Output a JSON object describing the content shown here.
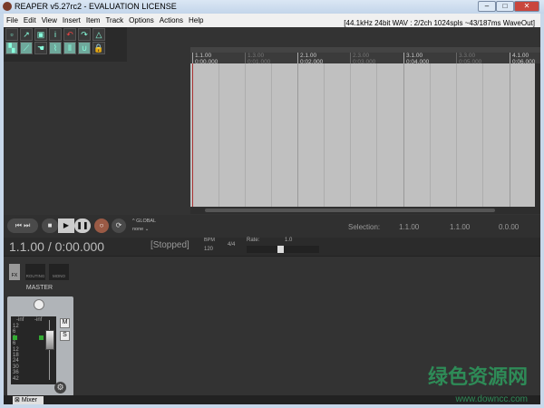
{
  "window": {
    "title": "REAPER v5.27rc2 - EVALUATION LICENSE"
  },
  "menu": [
    "File",
    "Edit",
    "View",
    "Insert",
    "Item",
    "Track",
    "Options",
    "Actions",
    "Help"
  ],
  "audio_format": "[44.1kHz 24bit WAV : 2/2ch 1024spls ~43/187ms WaveOut]",
  "ruler": [
    {
      "bar": "1.1.00",
      "time": "0:00.000",
      "major": true
    },
    {
      "bar": "1.3.00",
      "time": "0:01.000",
      "major": false
    },
    {
      "bar": "2.1.00",
      "time": "0:02.000",
      "major": true
    },
    {
      "bar": "2.3.00",
      "time": "0:03.000",
      "major": false
    },
    {
      "bar": "3.1.00",
      "time": "0:04.000",
      "major": true
    },
    {
      "bar": "3.3.00",
      "time": "0:05.000",
      "major": false
    },
    {
      "bar": "4.1.00",
      "time": "0:06.000",
      "major": true
    }
  ],
  "transport": {
    "global_label": "GLOBAL",
    "global_mode": "none",
    "selection_label": "Selection:",
    "sel_start": "1.1.00",
    "sel_end": "1.1.00",
    "sel_length": "0.0.00"
  },
  "status": {
    "position": "1.1.00 / 0:00.000",
    "state": "[Stopped]",
    "bpm_label": "BPM",
    "bpm": "120",
    "time_sig": "4/4",
    "rate_label": "Rate:",
    "rate": "1.0"
  },
  "mixer": {
    "fx": "FX",
    "routing": "ROUTING",
    "mono": "MONO",
    "master": "MASTER",
    "mute": "M",
    "solo": "S",
    "inf": "-inf",
    "scale": [
      "12",
      "6",
      "0",
      "6",
      "12",
      "18",
      "24",
      "30",
      "36",
      "42"
    ],
    "tab": "Mixer"
  },
  "watermark": {
    "text": "绿色资源网",
    "url": "www.downcc.com"
  }
}
